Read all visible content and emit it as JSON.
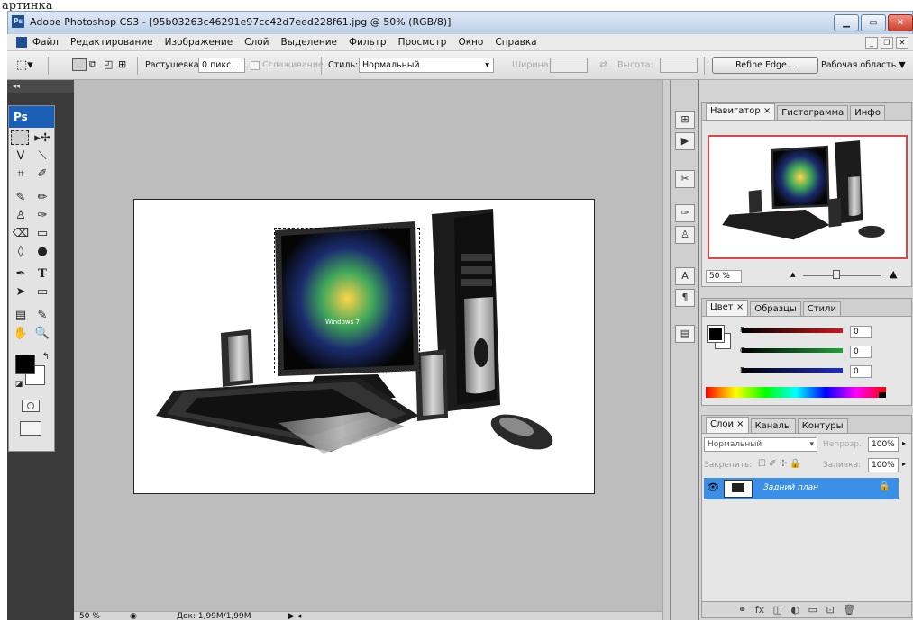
{
  "caption": "артинка",
  "window": {
    "title": "Adobe Photoshop CS3 - [95b03263c46291e97cc42d7eed228f61.jpg @ 50% (RGB/8)]",
    "app_icon_text": "Ps"
  },
  "menu": {
    "items": [
      "Файл",
      "Редактирование",
      "Изображение",
      "Слой",
      "Выделение",
      "Фильтр",
      "Просмотр",
      "Окно",
      "Справка"
    ]
  },
  "options": {
    "feather_label": "Растушевка:",
    "feather_value": "0 пикс.",
    "antialias_label": "Сглаживание",
    "style_label": "Стиль:",
    "style_value": "Нормальный",
    "width_label": "Ширина:",
    "height_label": "Высота:",
    "refine_edge": "Refine Edge...",
    "workspace": "Рабочая область ▼"
  },
  "toolbox": {
    "logo": "Ps"
  },
  "status": {
    "zoom": "50 %",
    "doc": "Док: 1,99M/1,99M"
  },
  "navigator": {
    "tabs": [
      "Навигатор ×",
      "Гистограмма",
      "Инфо"
    ],
    "zoom": "50 %"
  },
  "color_panel": {
    "tabs": [
      "Цвет ×",
      "Образцы",
      "Стили"
    ],
    "r_label": "R",
    "g_label": "G",
    "b_label": "B",
    "r": "0",
    "g": "0",
    "b": "0",
    "colors": {
      "r": "#d0161b",
      "g": "#1fa23a",
      "b": "#1d2fc9"
    }
  },
  "layers_panel": {
    "tabs": [
      "Слои ×",
      "Каналы",
      "Контуры"
    ],
    "blend_mode": "Нормальный",
    "opacity_label": "Непрозр.:",
    "opacity": "100%",
    "lock_label": "Закрепить:",
    "fill_label": "Заливка:",
    "fill": "100%",
    "layer_name": "Задний план",
    "selected_color": "#3c8fe6"
  },
  "document": {
    "screen_text": "Windows 7"
  }
}
